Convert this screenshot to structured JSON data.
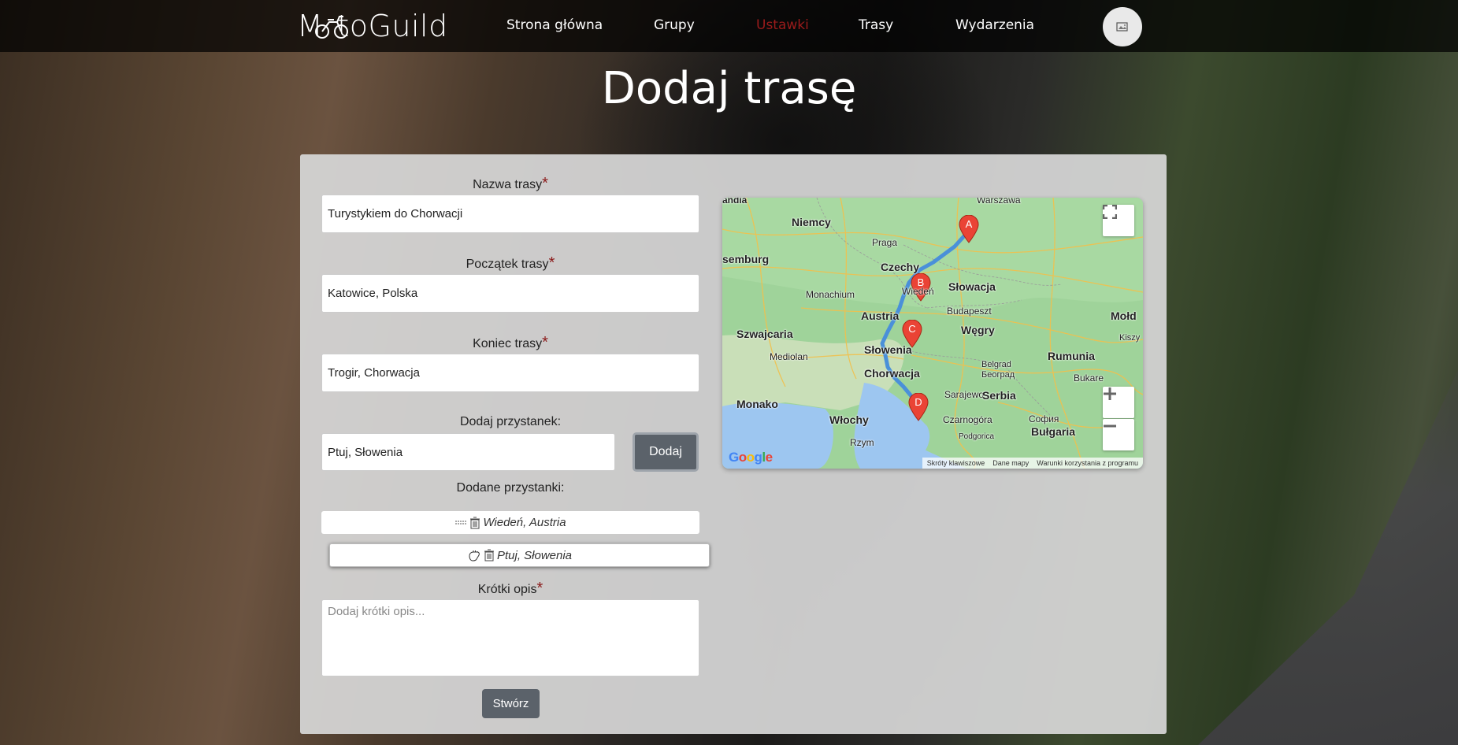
{
  "brand": {
    "name": "MotoGuild"
  },
  "nav": {
    "items": [
      {
        "label": "Strona główna"
      },
      {
        "label": "Grupy"
      },
      {
        "label": "Ustawki"
      },
      {
        "label": "Trasy"
      },
      {
        "label": "Wydarzenia"
      }
    ],
    "active_color": "#9a1b1b"
  },
  "page": {
    "title": "Dodaj trasę"
  },
  "form": {
    "route_name": {
      "label": "Nazwa trasy",
      "required_mark": "*",
      "value": "Turystykiem do Chorwacji"
    },
    "route_start": {
      "label": "Początek trasy",
      "required_mark": "*",
      "value": "Katowice, Polska"
    },
    "route_end": {
      "label": "Koniec trasy",
      "required_mark": "*",
      "value": "Trogir, Chorwacja"
    },
    "add_stop": {
      "label": "Dodaj przystanek:",
      "value": "Ptuj, Słowenia",
      "button": "Dodaj"
    },
    "stops": {
      "label": "Dodane przystanki:",
      "items": [
        {
          "name": "Wiedeń, Austria"
        },
        {
          "name": "Ptuj, Słowenia"
        }
      ]
    },
    "description": {
      "label": "Krótki opis",
      "required_mark": "*",
      "placeholder": "Dodaj krótki opis..."
    },
    "submit": "Stwórz"
  },
  "map": {
    "markers": [
      "A",
      "B",
      "C",
      "D"
    ],
    "places": {
      "warszawa": "Warszawa",
      "niemcy": "Niemcy",
      "praga": "Praga",
      "luksemburg": "semburg",
      "czechy": "Czechy",
      "slowacja": "Słowacja",
      "wieden": "Wiedeń",
      "monachium": "Monachium",
      "budapeszt": "Budapeszt",
      "austria": "Austria",
      "mold": "Mołd",
      "kiszy": "Kiszy",
      "szwajcaria": "Szwajcaria",
      "wegry": "Węgry",
      "slowenia": "Słowenia",
      "rumunia": "Rumunia",
      "mediolan": "Mediolan",
      "belgrad": "Belgrad",
      "belgrad_cyr": "Београд",
      "chorwacja": "Chorwacja",
      "bukareszt": "Bukare",
      "sarajewo": "Sarajewo",
      "serbia": "Serbia",
      "monako": "Monako",
      "wlochy": "Włochy",
      "czarnogora": "Czarnogóra",
      "sofia": "София",
      "bulgaria": "Bułgaria",
      "rzym": "Rzym",
      "podgorica": "Podgorica",
      "holandia": "andia"
    },
    "attribution": {
      "shortcuts": "Skróty klawiszowe",
      "map_data": "Dane mapy",
      "terms": "Warunki korzystania z programu"
    },
    "google": "Google",
    "route_color": "#4a90d9",
    "marker_color": "#ea4335"
  }
}
